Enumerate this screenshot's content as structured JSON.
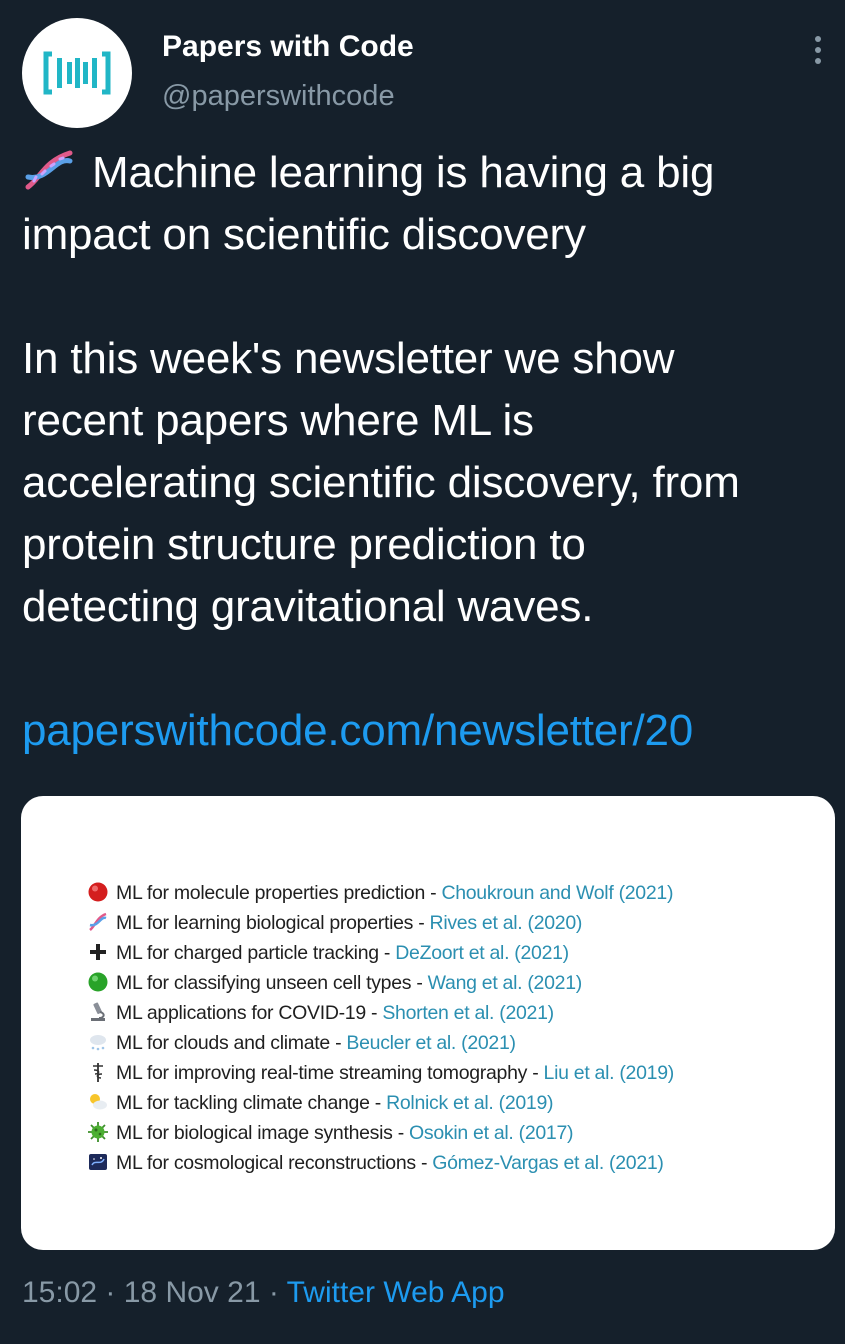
{
  "author": {
    "display_name": "Papers with Code",
    "handle": "@paperswithcode",
    "avatar_icon": "paperswithcode-logo"
  },
  "menu_icon": "more-vertical-icon",
  "tweet": {
    "emoji_icon": "dna-icon",
    "line1": "Machine learning is having a big",
    "line2": "impact on scientific discovery",
    "line3": "In this week's newsletter we show",
    "line4": "recent papers where ML is",
    "line5": "accelerating scientific discovery, from",
    "line6": "protein structure prediction to",
    "line7": "detecting gravitational waves.",
    "link": "paperswithcode.com/newsletter/20"
  },
  "card": {
    "items": [
      {
        "icon": "red-circle-icon",
        "text": "ML for molecule properties prediction",
        "sep": " - ",
        "cite": "Choukroun and Wolf (2021)"
      },
      {
        "icon": "dna-icon",
        "text": "ML for learning biological properties ",
        "sep": " - ",
        "cite": "Rives et al. (2020)"
      },
      {
        "icon": "plus-icon",
        "text": "ML for charged particle tracking",
        "sep": " - ",
        "cite": "DeZoort et al. (2021)"
      },
      {
        "icon": "green-circle-icon",
        "text": "ML for classifying unseen cell types",
        "sep": " - ",
        "cite": "Wang et al. (2021)"
      },
      {
        "icon": "microscope-icon",
        "text": "ML applications for COVID-19",
        "sep": " - ",
        "cite": "Shorten et al. (2021)"
      },
      {
        "icon": "cloud-snow-icon",
        "text": "ML for clouds and climate",
        "sep": " - ",
        "cite": "Beucler et al. (2021)"
      },
      {
        "icon": "caduceus-icon",
        "text": "ML for improving real-time streaming tomography",
        "sep": " - ",
        "cite": "Liu et al. (2019)"
      },
      {
        "icon": "sun-cloud-icon",
        "text": "ML for tackling climate change",
        "sep": " - ",
        "cite": "Rolnick et al. (2019)"
      },
      {
        "icon": "microbe-icon",
        "text": "ML for biological image synthesis",
        "sep": " - ",
        "cite": "Osokin et al. (2017)"
      },
      {
        "icon": "galaxy-icon",
        "text": "ML for cosmological reconstructions",
        "sep": " - ",
        "cite": "Gómez-Vargas et al. (2021)"
      }
    ]
  },
  "footer": {
    "time": "15:02",
    "dot1": " · ",
    "date": "18 Nov 21",
    "dot2": " · ",
    "app": "Twitter Web App"
  },
  "colors": {
    "background": "#15202b",
    "link": "#1d9bf0",
    "secondary_text": "#8899a6",
    "citation": "#2b8fb1"
  }
}
